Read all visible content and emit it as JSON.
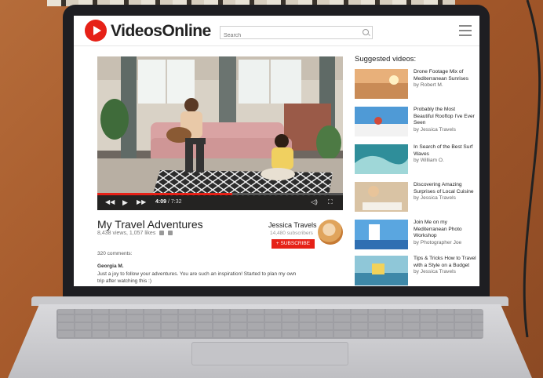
{
  "header": {
    "brand": "VideosOnline",
    "search_placeholder": "Search"
  },
  "video": {
    "title": "My Travel Adventures",
    "current_time": "4:09",
    "total_time": "7:32",
    "progress": 0.55,
    "views": "8,438 views, 1,057 likes"
  },
  "channel": {
    "name": "Jessica Travels",
    "subscribers": "14,480 subscribers",
    "subscribe_label": "+ SUBSCRIBE"
  },
  "comments": {
    "count": "320 comments:",
    "items": [
      {
        "user": "Georgia M.",
        "text": "Just a joy to follow your adventures. You are such an inspiration! Started to plan my own trip after watching this :)"
      }
    ]
  },
  "suggested": {
    "heading": "Suggested videos:",
    "items": [
      {
        "title": "Drone Footage Mix of Mediterranean Sunrises",
        "author": "by Robert M.",
        "thumb": "sunrise"
      },
      {
        "title": "Probably the Most Beautiful Rooftop I've Ever Seen",
        "author": "by Jessica Travels",
        "thumb": "rooftop"
      },
      {
        "title": "In Search of the Best Surf Waves",
        "author": "by William O.",
        "thumb": "waves"
      },
      {
        "title": "Discovering Amazing Surprises of Local Cuisine",
        "author": "by Jessica Travels",
        "thumb": "cuisine"
      },
      {
        "title": "Join Me on my Mediterranean Photo Workshop",
        "author": "by Photographer Joe",
        "thumb": "photo"
      },
      {
        "title": "Tips & Tricks How to Travel with a Style on a Budget",
        "author": "by Jessica Travels",
        "thumb": "budget"
      }
    ]
  },
  "colors": {
    "accent": "#e62117",
    "bezel": "#1e1e22"
  }
}
